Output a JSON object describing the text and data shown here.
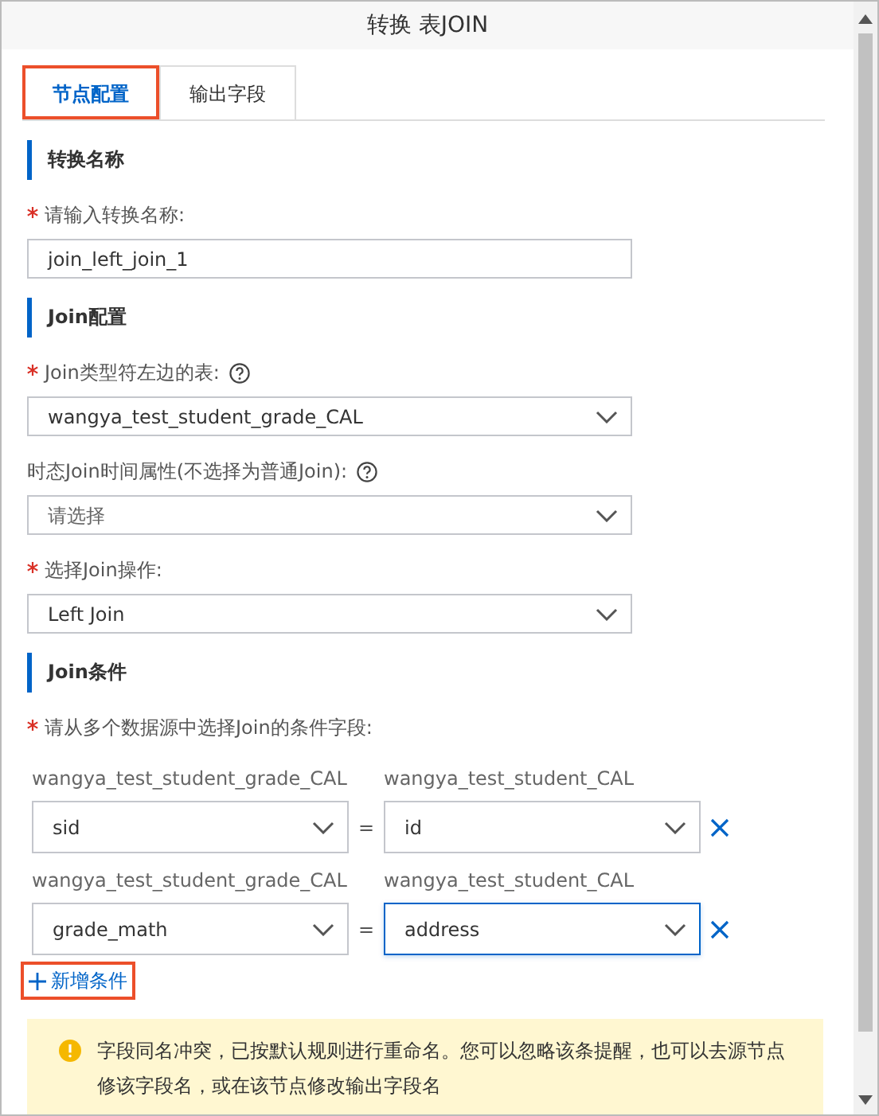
{
  "window": {
    "title": "转换 表JOIN"
  },
  "tabs": [
    {
      "label": "节点配置",
      "selected": true,
      "highlighted": true
    },
    {
      "label": "输出字段",
      "selected": false,
      "highlighted": false
    }
  ],
  "sections": [
    {
      "title": "转换名称",
      "fields": [
        {
          "kind": "input",
          "label": "请输入转换名称:",
          "required": true,
          "help": false,
          "value": "join_left_join_1"
        }
      ]
    },
    {
      "title": "Join配置",
      "fields": [
        {
          "kind": "select",
          "label": "Join类型符左边的表:",
          "required": true,
          "help": true,
          "value": "wangya_test_student_grade_CAL"
        },
        {
          "kind": "select",
          "label": "时态Join时间属性(不选择为普通Join):",
          "required": false,
          "help": true,
          "placeholder": "请选择"
        },
        {
          "kind": "select",
          "label": "选择Join操作:",
          "required": true,
          "help": false,
          "value": "Left Join"
        }
      ]
    },
    {
      "title": "Join条件",
      "fields": [
        {
          "kind": "conditions",
          "label": "请从多个数据源中选择Join的条件字段:",
          "required": true,
          "help": false
        }
      ]
    }
  ],
  "conditions": [
    {
      "left_source": "wangya_test_student_grade_CAL",
      "left_value": "sid",
      "operator": "=",
      "right_source": "wangya_test_student_CAL",
      "right_value": "id",
      "right_focused": false
    },
    {
      "left_source": "wangya_test_student_grade_CAL",
      "left_value": "grade_math",
      "operator": "=",
      "right_source": "wangya_test_student_CAL",
      "right_value": "address",
      "right_focused": true
    }
  ],
  "add_condition": {
    "label": "新增条件",
    "highlighted": true
  },
  "warning": {
    "text": "字段同名冲突，已按默认规则进行重命名。您可以忽略该条提醒，也可以去源节点修该字段名，或在该节点修改输出字段名"
  }
}
